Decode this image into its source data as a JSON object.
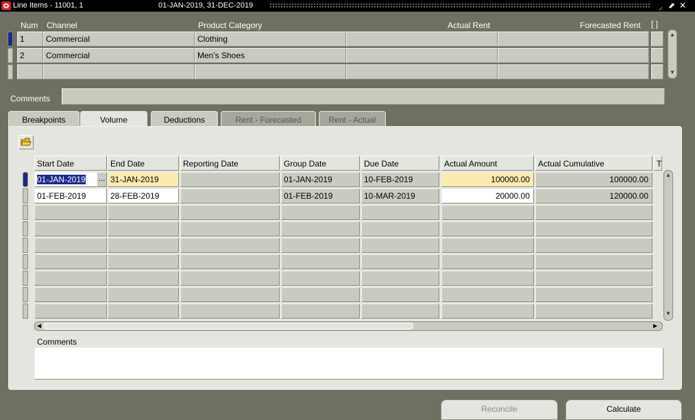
{
  "window": {
    "title_prefix": "Line Items - 11001, 1",
    "title_suffix": "01-JAN-2019, 31-DEC-2019",
    "minimize": "⸝",
    "restore": "⬈",
    "close": "✕"
  },
  "line_items": {
    "headers": {
      "num": "Num",
      "channel": "Channel",
      "product_category": "Product Category",
      "actual_rent": "Actual Rent",
      "forecasted_rent": "Forecasted Rent",
      "bracket": "[ ]"
    },
    "rows": [
      {
        "num": "1",
        "channel": "Commercial",
        "product_category": "Clothing",
        "actual_rent": "",
        "forecasted_rent": ""
      },
      {
        "num": "2",
        "channel": "Commercial",
        "product_category": "Men's Shoes",
        "actual_rent": "",
        "forecasted_rent": ""
      },
      {
        "num": "",
        "channel": "",
        "product_category": "",
        "actual_rent": "",
        "forecasted_rent": ""
      }
    ]
  },
  "comments_label": "Comments",
  "comments_value": "",
  "tabs": [
    {
      "label": "Breakpoints",
      "state": "normal"
    },
    {
      "label": "Volume",
      "state": "active"
    },
    {
      "label": "Deductions",
      "state": "normal"
    },
    {
      "label": "Rent - Forecasted",
      "state": "disabled"
    },
    {
      "label": "Rent - Actual",
      "state": "disabled"
    }
  ],
  "volume": {
    "headers": [
      "Start Date",
      "End Date",
      "Reporting Date",
      "Group Date",
      "Due Date",
      "Actual Amount",
      "Actual Cumulative",
      "Tr"
    ],
    "rows": [
      {
        "start": "01-JAN-2019",
        "end": "31-JAN-2019",
        "reporting": "",
        "group": "01-JAN-2019",
        "due": "10-FEB-2019",
        "amount": "100000.00",
        "cumulative": "100000.00"
      },
      {
        "start": "01-FEB-2019",
        "end": "28-FEB-2019",
        "reporting": "",
        "group": "01-FEB-2019",
        "due": "10-MAR-2019",
        "amount": "20000.00",
        "cumulative": "120000.00"
      }
    ],
    "empty_rows": 7,
    "lov_button": "...",
    "comments_label": "Comments",
    "comments_value": ""
  },
  "buttons": {
    "reconcile": "Reconcile",
    "calculate": "Calculate"
  },
  "colors": {
    "background": "#6e7061",
    "panel": "#e4e5de",
    "field": "#c9cbc0",
    "current_field": "#fcebb0",
    "selected_text": "#1c2a8a"
  }
}
